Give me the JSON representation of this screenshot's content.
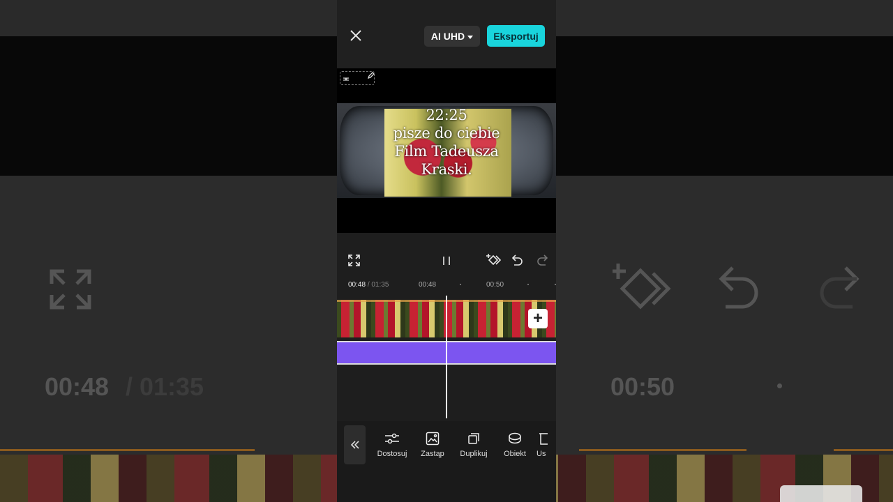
{
  "header": {
    "quality_label": "AI UHD",
    "export_label": "Eksportuj"
  },
  "preview": {
    "overlay_text": "22:25\npisze do ciebie\n Film Tadeusza\nKraski."
  },
  "timeline": {
    "current_time": "00:48",
    "total_time": "/ 01:35",
    "ticks": [
      "00:48",
      "00:50"
    ]
  },
  "background": {
    "current_time": "00:48",
    "total_time": "/ 01:35",
    "tick": "00:50"
  },
  "toolbar": {
    "items": [
      {
        "label": "Dostosuj",
        "icon": "sliders-icon"
      },
      {
        "label": "Zastąp",
        "icon": "replace-image-icon"
      },
      {
        "label": "Duplikuj",
        "icon": "duplicate-icon"
      },
      {
        "label": "Obiekt",
        "icon": "object-icon"
      },
      {
        "label": "Us",
        "icon": "delete-icon"
      }
    ]
  },
  "colors": {
    "export_accent": "#19d4dc",
    "audio_track": "#7c55f0",
    "background": "#1e1e1e"
  }
}
